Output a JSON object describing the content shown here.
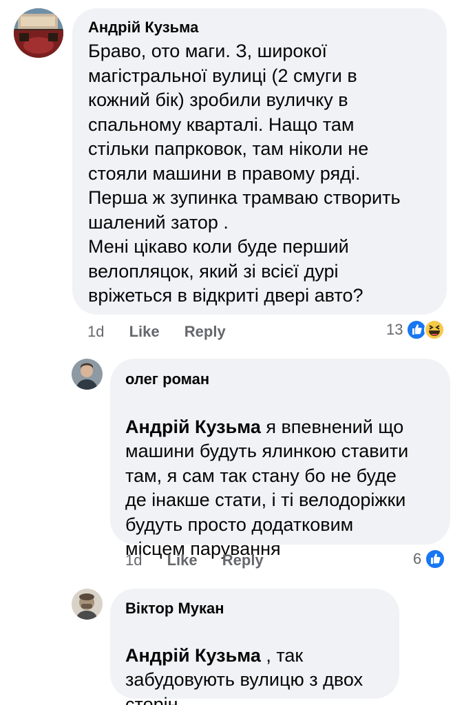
{
  "comments": [
    {
      "author": "Андрій Кузьма",
      "mention": "",
      "text": "Браво, ото маги. З, широкої\nмагістральної вулиці (2 смуги в\nкожний бік)  зробили вуличку в\nспальному кварталі. Нащо там\nстільки папрковок,  там ніколи не\nстояли машини в правому ряді.\nПерша ж зупинка трамваю створить\nшалений затор .\nМені цікаво коли буде перший\nвелопляцок, який зі всієї дурі\nвріжеться в відкриті двері авто?",
      "time": "1d",
      "like_label": "Like",
      "reply_label": "Reply",
      "reaction_count": "13",
      "reactions": [
        "like-icon",
        "haha-icon"
      ]
    },
    {
      "author": "олег роман",
      "mention": "Андрій Кузьма",
      "text": "   я впевнений що\nмашини будуть ялинкою ставити\nтам, я сам так стану бо не буде\nде інакше стати, і ті велодоріжки\nбудуть просто додатковим\nмісцем парування",
      "time": "1d",
      "like_label": "Like",
      "reply_label": "Reply",
      "reaction_count": "6",
      "reactions": [
        "like-icon"
      ]
    },
    {
      "author": "Віктор Мукан",
      "mention": "Андрій Кузьма",
      "text": " , так\nзабудовують вулицю з двох\nсторін,"
    }
  ],
  "colors": {
    "bubble": "#f0f2f5",
    "meta": "#65676b",
    "like_blue": "#1877f2",
    "haha_yellow": "#f7c948"
  }
}
